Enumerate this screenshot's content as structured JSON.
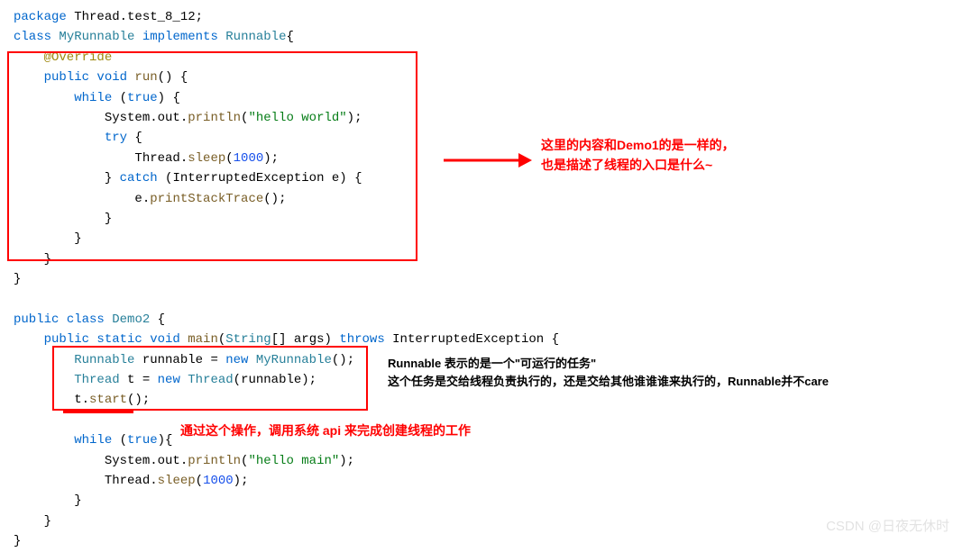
{
  "code": {
    "l1_package": "package",
    "l1_pkg_name": " Thread.test_8_12;",
    "l2_class": "class",
    "l2_name": " MyRunnable ",
    "l2_impl": "implements",
    "l2_intf": " Runnable",
    "l2_brace": "{",
    "l3_override": "    @Override",
    "l4_public": "    public",
    "l4_void": " void",
    "l4_run": " run",
    "l4_paren": "() {",
    "l5_while": "        while",
    "l5_cond": " (",
    "l5_true": "true",
    "l5_end": ") {",
    "l6_sys": "            System.out.",
    "l6_print": "println",
    "l6_open": "(",
    "l6_str": "\"hello world\"",
    "l6_close": ");",
    "l7_try": "            try",
    "l7_brace": " {",
    "l8_thread": "                Thread.",
    "l8_sleep": "sleep",
    "l8_open": "(",
    "l8_num": "1000",
    "l8_close": ");",
    "l9_close": "            } ",
    "l9_catch": "catch",
    "l9_paren": " (InterruptedException e) {",
    "l10_e": "                e.",
    "l10_print": "printStackTrace",
    "l10_end": "();",
    "l11": "            }",
    "l12": "        }",
    "l13": "    }",
    "l14": "}",
    "l16_public": "public",
    "l16_class": " class",
    "l16_name": " Demo2 ",
    "l16_brace": "{",
    "l17_public": "    public",
    "l17_static": " static",
    "l17_void": " void",
    "l17_main": " main",
    "l17_open": "(",
    "l17_string": "String",
    "l17_args": "[] args) ",
    "l17_throws": "throws",
    "l17_exc": " InterruptedException ",
    "l17_brace": "{",
    "l18_type": "        Runnable ",
    "l18_var": "runnable = ",
    "l18_new": "new",
    "l18_cls": " MyRunnable",
    "l18_end": "();",
    "l19_type": "        Thread ",
    "l19_var": "t = ",
    "l19_new": "new",
    "l19_cls": " Thread",
    "l19_end": "(runnable);",
    "l20_t": "        t.",
    "l20_start": "start",
    "l20_end": "();",
    "l22_while": "        while",
    "l22_cond": " (",
    "l22_true": "true",
    "l22_end": "){",
    "l23_sys": "            System.out.",
    "l23_print": "println",
    "l23_open": "(",
    "l23_str": "\"hello main\"",
    "l23_close": ");",
    "l24_thread": "            Thread.",
    "l24_sleep": "sleep",
    "l24_open": "(",
    "l24_num": "1000",
    "l24_close": ");",
    "l25": "        }",
    "l26": "    }",
    "l27": "}"
  },
  "annotations": {
    "right1_line1": "这里的内容和Demo1的是一样的，",
    "right1_line2": "也是描述了线程的入口是什么~",
    "right2_line1": "Runnable 表示的是一个\"可运行的任务\"",
    "right2_line2": "这个任务是交给线程负责执行的，还是交给其他谁谁谁来执行的，Runnable并不care",
    "bottom": "通过这个操作，调用系统 api 来完成创建线程的工作"
  },
  "watermark": "CSDN @日夜无休时"
}
